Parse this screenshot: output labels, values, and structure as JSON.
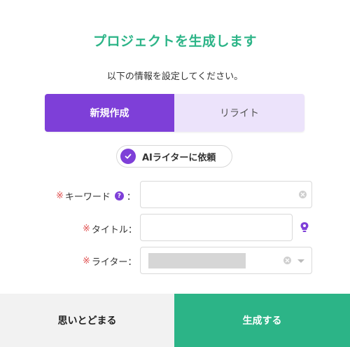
{
  "dialog": {
    "title": "プロジェクトを生成します",
    "subtitle": "以下の情報を設定してください。"
  },
  "mode_tabs": [
    {
      "label": "新規作成",
      "active": true
    },
    {
      "label": "リライト",
      "active": false
    }
  ],
  "ai_writer_toggle": {
    "label": "AIライターに依頼",
    "checked": true
  },
  "form": {
    "required_mark": "※",
    "colon": "：",
    "keyword": {
      "label": "キーワード",
      "help": "?",
      "value": ""
    },
    "title": {
      "label": "タイトル",
      "value": ""
    },
    "writer": {
      "label": "ライター"
    }
  },
  "footer": {
    "cancel_label": "思いとどまる",
    "submit_label": "生成する"
  },
  "colors": {
    "accent_green": "#2cb487",
    "accent_purple": "#7e3fd8",
    "tab_inactive_bg": "#ece3fb",
    "required_red": "#e05050"
  },
  "icons": [
    "check-icon",
    "help-icon",
    "clear-icon",
    "bulb-icon",
    "chevron-down-icon"
  ]
}
